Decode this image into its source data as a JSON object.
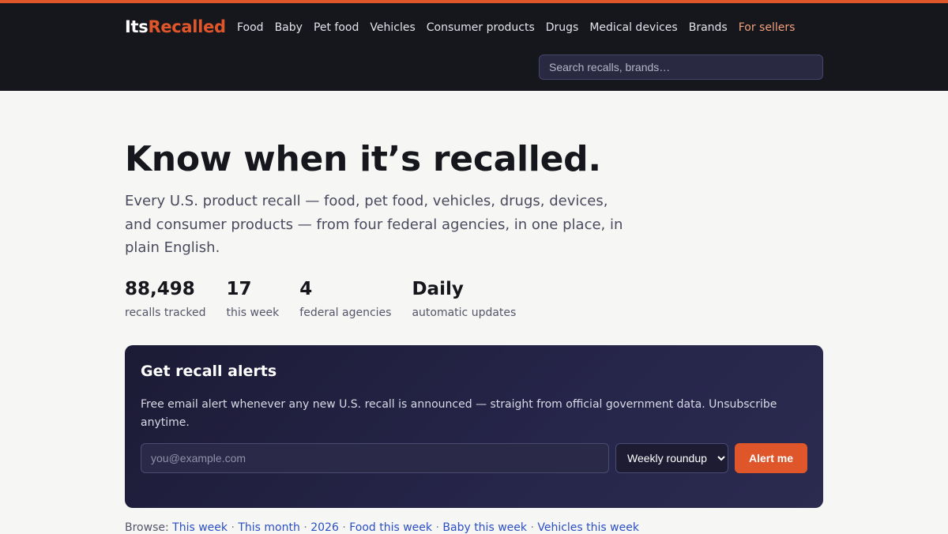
{
  "header": {
    "brand_part1": "Its",
    "brand_part2": "Recalled",
    "nav": [
      "Food",
      "Baby",
      "Pet food",
      "Vehicles",
      "Consumer products",
      "Drugs",
      "Medical devices",
      "Brands",
      "For sellers"
    ],
    "search_placeholder": "Search recalls, brands…"
  },
  "hero": {
    "headline": "Know when it’s recalled.",
    "subtitle": "Every U.S. product recall — food, pet food, vehicles, drugs, devices, and consumer products — from four federal agencies, in one place, in plain English."
  },
  "stats": [
    {
      "value": "88,498",
      "label": "recalls tracked"
    },
    {
      "value": "17",
      "label": "this week"
    },
    {
      "value": "4",
      "label": "federal agencies"
    },
    {
      "value": "Daily",
      "label": "automatic updates"
    }
  ],
  "alerts": {
    "title": "Get recall alerts",
    "description": "Free email alert whenever any new U.S. recall is announced — straight from official government data. Unsubscribe anytime.",
    "email_placeholder": "you@example.com",
    "frequency_selected": "Weekly roundup",
    "button_label": "Alert me"
  },
  "browse": {
    "prefix": "Browse:",
    "separator": "·",
    "links": [
      "This week",
      "This month",
      "2026",
      "Food this week",
      "Baby this week",
      "Vehicles this week"
    ]
  },
  "colors": {
    "accent": "#e0562b",
    "header_bg": "#16161d",
    "link": "#2b4fc6"
  }
}
